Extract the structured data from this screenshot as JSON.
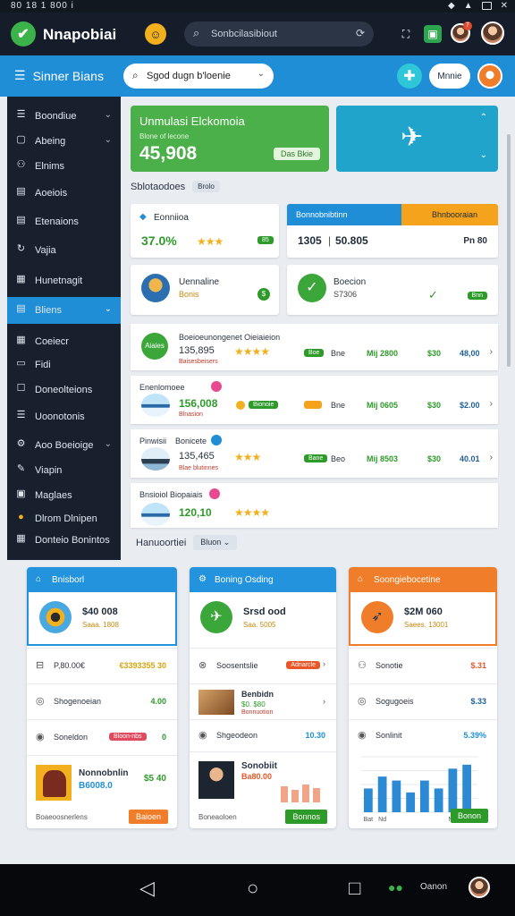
{
  "status_bar": {
    "time": "80 18 1 800 i"
  },
  "header": {
    "app_name": "Nnapobiai",
    "search_placeholder": "Sonbcilasibiout",
    "badge_count": "7"
  },
  "toolbar": {
    "title": "Sinner Bians",
    "select_value": "Sgod dugn b'loenie",
    "pill_label": "Mnnie"
  },
  "sidebar": {
    "items": [
      {
        "label": "Boondiue",
        "chevron": true,
        "icon": "list-icon"
      },
      {
        "label": "Abeing",
        "chevron": true,
        "icon": "box-icon"
      },
      {
        "label": "Elnims",
        "chevron": false,
        "icon": "people-icon"
      },
      {
        "label": "Aoeiois",
        "chevron": false,
        "icon": "doc-icon"
      },
      {
        "label": "Etenaions",
        "chevron": false,
        "icon": "doc-icon"
      },
      {
        "label": "Vajia",
        "chevron": false,
        "icon": "refresh-icon"
      },
      {
        "label": "Hunetnagit",
        "chevron": false,
        "icon": "calendar-icon"
      },
      {
        "label": "Bliens",
        "chevron": true,
        "icon": "doc-icon",
        "active": true
      },
      {
        "label": "Coeiecr",
        "chevron": false,
        "icon": "grid-icon"
      },
      {
        "label": "Fidi",
        "chevron": false,
        "icon": "folder-icon"
      },
      {
        "label": "Doneolteions",
        "chevron": false,
        "icon": "checkbox-icon"
      },
      {
        "label": "Uoonotonis",
        "chevron": false,
        "icon": "list-icon"
      },
      {
        "label": "Aoo Boeioige",
        "chevron": true,
        "icon": "gear-icon"
      },
      {
        "label": "Viapin",
        "chevron": false,
        "icon": "pen-icon"
      },
      {
        "label": "Maglaes",
        "chevron": false,
        "icon": "tag-icon"
      },
      {
        "label": "Dlrom Dlnipen",
        "chevron": false,
        "icon": "coin-icon"
      },
      {
        "label": "Donteio Bonintos",
        "chevron": false,
        "icon": "grid-icon"
      }
    ]
  },
  "sim_card": {
    "title": "Unmulasi Elckomoia",
    "subtitle": "Blone of lecone",
    "value": "45,908",
    "button": "Das Bkie"
  },
  "section_filter": {
    "label": "Sblotaodoes",
    "pill": "Brolo"
  },
  "card1": {
    "title": "Eonniioa",
    "percent": "37.0%",
    "stars": "★★★",
    "badge": "85"
  },
  "card2": {
    "head_left": "Bonnobnibtinn",
    "head_right": "Bhnbooraian",
    "value1": "1305",
    "value2": "50.805",
    "right": "Pn 80"
  },
  "card3": {
    "title": "Uennaline",
    "sub": "Bonis"
  },
  "card4": {
    "title": "Boecion",
    "sub": "S7306",
    "chip": "Bnn"
  },
  "list_rows": [
    {
      "title": "Boeioeunongenet Oieiaieion",
      "badge": "Aiaies",
      "num": "135,895",
      "sub": "Baisesbeisers",
      "stars": "★★★★",
      "chip": "Boe",
      "cell1": "Bne",
      "cell2": "Mij 2800",
      "cell3": "$30",
      "cell4": "48,00"
    },
    {
      "title": "Enenlomoee",
      "num": "156,008",
      "sub": "Blnasion",
      "chip": "Bionoie",
      "cell1": "Bne",
      "cell2": "Mij 0605",
      "cell3": "$30",
      "cell4": "$2.00"
    },
    {
      "title": "Pinwisii",
      "title2": "Bonicete",
      "num": "135,465",
      "sub": "Blae blutinnes",
      "stars": "★★★",
      "chip": "Bane",
      "cell1": "Beo",
      "cell2": "Mij 8503",
      "cell3": "$30",
      "cell4": "40.01"
    },
    {
      "title": "Bnsioiol Biopaiais",
      "num": "120,10",
      "stars": "★★★★"
    }
  ],
  "bottom_label": {
    "label": "Hanuoortiei",
    "pill": "Bluon"
  },
  "panels": [
    {
      "header": "Bnisborl",
      "color": "#2293dc",
      "top_value": "$40 008",
      "top_sub": "Saaa. 1808",
      "rows": [
        {
          "label": "P,80.00€",
          "value": "€3393355 30",
          "icon": "cart-icon"
        },
        {
          "label": "Shogenoeian",
          "value": "4.00",
          "icon": "user-icon"
        },
        {
          "label": "Soneldon",
          "value": "0",
          "chip": "Bloon-nbs",
          "icon": "person-icon"
        }
      ],
      "promo_title": "Nonnobnlin",
      "promo_value": "B6008.0",
      "promo_price": "$5 40",
      "footer_label": "Boaeoosnerlens",
      "footer_button": "Baioen"
    },
    {
      "header": "Boning Osding",
      "color": "#2293dc",
      "top_value": "Srsd ood",
      "top_sub": "Saa. 5005",
      "rows": [
        {
          "label": "Soosentslie",
          "value": "Adnarcle",
          "icon": "cart-icon"
        },
        {
          "label": "Benbidn",
          "value": "$0. $80",
          "icon": "box-icon",
          "sub": "Bonnuotion"
        },
        {
          "label": "Shgeodeon",
          "value": "10.30",
          "icon": "person-icon"
        }
      ],
      "promo_title": "Sonobiit",
      "promo_value": "Ba80.00",
      "footer_label": "Boneaoloen",
      "footer_button": "Bonnos"
    },
    {
      "header": "Soongiebocetine",
      "color": "#f07d29",
      "top_value": "$2M 060",
      "top_sub": "Saees. 13001",
      "rows": [
        {
          "label": "Sonotie",
          "value": "$.31",
          "icon": "person-icon"
        },
        {
          "label": "Sogugoeis",
          "value": "$.33",
          "icon": "user-icon"
        },
        {
          "label": "Sonlinit",
          "value": "5.39%",
          "icon": "person-icon"
        }
      ],
      "chart_data": {
        "type": "bar",
        "categories": [
          "Bat",
          "Nd",
          "",
          "",
          "",
          "",
          "Nis",
          ""
        ],
        "values": [
          6,
          9,
          8,
          5,
          8,
          6,
          11,
          12
        ],
        "ylim": [
          0,
          14
        ]
      },
      "footer_button": "Bonon"
    }
  ]
}
